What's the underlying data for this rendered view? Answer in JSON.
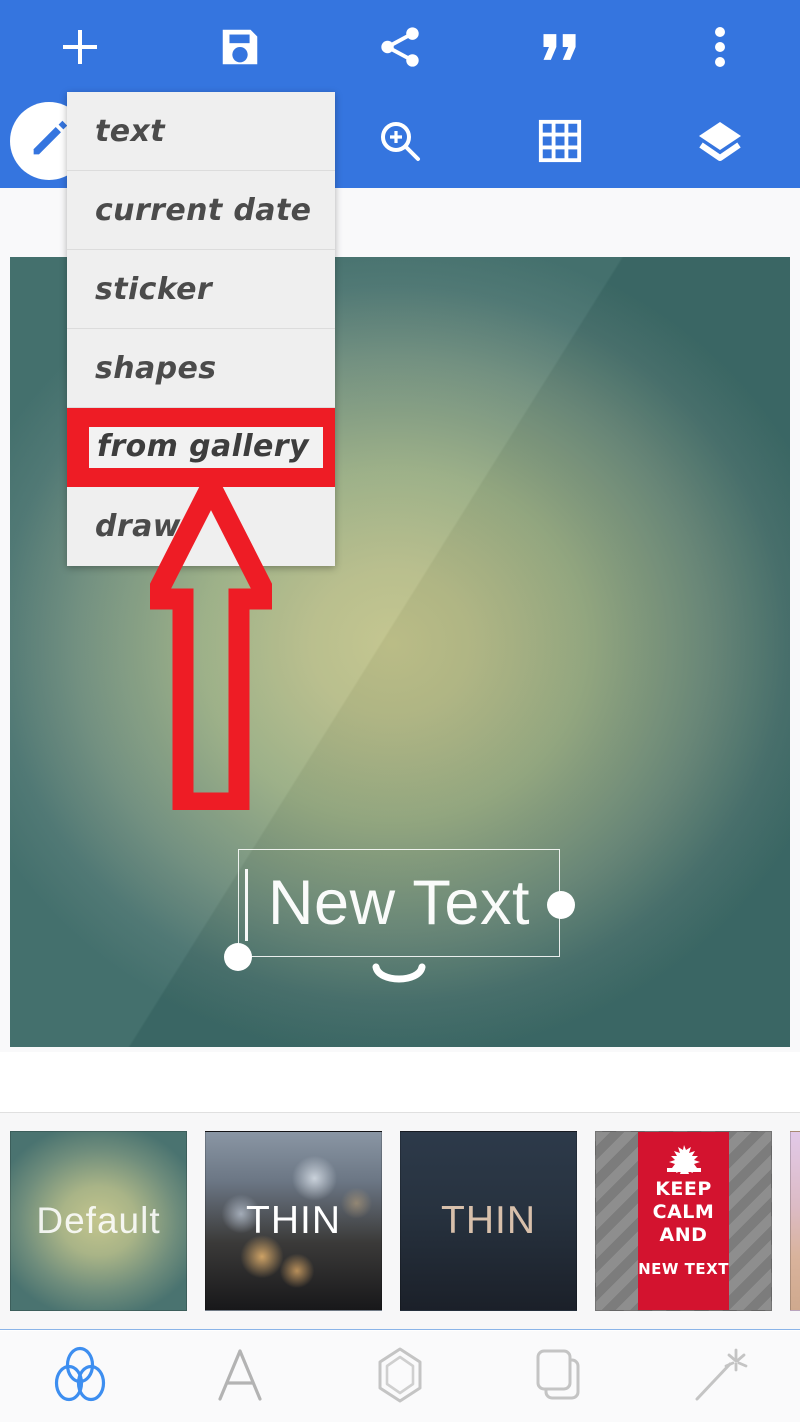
{
  "app": {
    "accent_blue": "#3575df",
    "highlight_red": "#ee1c25",
    "menu_bg": "#efefef"
  },
  "toolbar": {
    "row_top": [
      {
        "name": "add-icon",
        "label": "add"
      },
      {
        "name": "save-icon",
        "label": "save"
      },
      {
        "name": "share-icon",
        "label": "share"
      },
      {
        "name": "quote-icon",
        "label": "quote"
      },
      {
        "name": "overflow-menu-icon",
        "label": "more options"
      }
    ],
    "row_bottom": [
      {
        "name": "edit-pencil-icon",
        "label": "edit"
      },
      {
        "name": "zoom-in-icon",
        "label": "zoom in"
      },
      {
        "name": "grid-icon",
        "label": "grid"
      },
      {
        "name": "layers-icon",
        "label": "layers"
      }
    ]
  },
  "dropdown": {
    "items": [
      {
        "label": "text",
        "highlighted": false
      },
      {
        "label": "current date",
        "highlighted": false
      },
      {
        "label": "sticker",
        "highlighted": false
      },
      {
        "label": "shapes",
        "highlighted": false
      },
      {
        "label": "from gallery",
        "highlighted": true
      },
      {
        "label": "draw",
        "highlighted": false
      }
    ]
  },
  "canvas": {
    "text_object": {
      "value": "New Text",
      "color": "#ffffff"
    },
    "background_center": "#c2c48c",
    "background_edge": "#3d6b68"
  },
  "annotation": {
    "arrow_color": "#ee1c25",
    "points_to": "from gallery"
  },
  "thumbnails": [
    {
      "label": "Default",
      "style": "default"
    },
    {
      "label": "THIN",
      "style": "bokeh"
    },
    {
      "label": "THIN",
      "style": "dark-navy"
    },
    {
      "label": "",
      "style": "keep-calm",
      "lines": [
        "KEEP",
        "CALM",
        "AND"
      ],
      "subline": "NEW TEXT"
    },
    {
      "label": "",
      "style": "partial"
    }
  ],
  "bottom_nav": [
    {
      "name": "filters-icon",
      "label": "filters",
      "active": true
    },
    {
      "name": "text-tool-icon",
      "label": "text",
      "active": false
    },
    {
      "name": "shape-tool-icon",
      "label": "shapes",
      "active": false
    },
    {
      "name": "layers-tool-icon",
      "label": "layers",
      "active": false
    },
    {
      "name": "magic-wand-icon",
      "label": "effects",
      "active": false
    }
  ]
}
